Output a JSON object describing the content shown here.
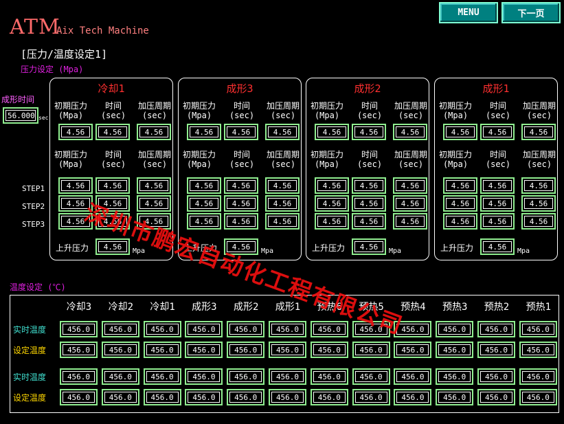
{
  "header": {
    "logo": "ATM",
    "logo_sub": "Aix Tech Machine",
    "menu_label": "MENU",
    "next_label": "下一页",
    "page_title": "[压力/温度设定1]"
  },
  "colors": {
    "accent": "#008080",
    "frame": "#90ee90",
    "title_red": "#ff3030",
    "magenta": "#e020e0",
    "cyan": "#40e0d0",
    "yellow": "#ffd700"
  },
  "pressure": {
    "section_label": "压力设定 (Mpa)",
    "forming_time_label": "成形时间",
    "forming_time_value": "56.000",
    "forming_time_unit": "sec",
    "step_labels": [
      "STEP1",
      "STEP2",
      "STEP3"
    ],
    "rise_label": "上升压力",
    "rise_unit": "Mpa",
    "headers": [
      {
        "name": "初期压力",
        "unit": "(Mpa)"
      },
      {
        "name": "时间",
        "unit": "(sec)"
      },
      {
        "name": "加压周期",
        "unit": "(sec)"
      }
    ],
    "panels": [
      {
        "title": "冷却1",
        "init": [
          "4.56",
          "4.56",
          "4.56"
        ],
        "steps": [
          [
            "4.56",
            "4.56",
            "4.56"
          ],
          [
            "4.56",
            "4.56",
            "4.56"
          ],
          [
            "4.56",
            "4.56",
            "4.56"
          ]
        ],
        "rise": "4.56"
      },
      {
        "title": "成形3",
        "init": [
          "4.56",
          "4.56",
          "4.56"
        ],
        "steps": [
          [
            "4.56",
            "4.56",
            "4.56"
          ],
          [
            "4.56",
            "4.56",
            "4.56"
          ],
          [
            "4.56",
            "4.56",
            "4.56"
          ]
        ],
        "rise": "4.56"
      },
      {
        "title": "成形2",
        "init": [
          "4.56",
          "4.56",
          "4.56"
        ],
        "steps": [
          [
            "4.56",
            "4.56",
            "4.56"
          ],
          [
            "4.56",
            "4.56",
            "4.56"
          ],
          [
            "4.56",
            "4.56",
            "4.56"
          ]
        ],
        "rise": "4.56"
      },
      {
        "title": "成形1",
        "init": [
          "4.56",
          "4.56",
          "4.56"
        ],
        "steps": [
          [
            "4.56",
            "4.56",
            "4.56"
          ],
          [
            "4.56",
            "4.56",
            "4.56"
          ],
          [
            "4.56",
            "4.56",
            "4.56"
          ]
        ],
        "rise": "4.56"
      }
    ]
  },
  "temperature": {
    "section_label": "温度设定 (℃)",
    "columns": [
      "冷却3",
      "冷却2",
      "冷却1",
      "成形3",
      "成形2",
      "成形1",
      "预热6",
      "预热5",
      "预热4",
      "预热3",
      "预热2",
      "预热1"
    ],
    "rows": [
      {
        "label": "实时温度",
        "values": [
          "456.0",
          "456.0",
          "456.0",
          "456.0",
          "456.0",
          "456.0",
          "456.0",
          "456.0",
          "456.0",
          "456.0",
          "456.0",
          "456.0"
        ]
      },
      {
        "label": "设定温度",
        "values": [
          "456.0",
          "456.0",
          "456.0",
          "456.0",
          "456.0",
          "456.0",
          "456.0",
          "456.0",
          "456.0",
          "456.0",
          "456.0",
          "456.0"
        ]
      },
      {
        "label": "实时温度",
        "values": [
          "456.0",
          "456.0",
          "456.0",
          "456.0",
          "456.0",
          "456.0",
          "456.0",
          "456.0",
          "456.0",
          "456.0",
          "456.0",
          "456.0"
        ]
      },
      {
        "label": "设定温度",
        "values": [
          "456.0",
          "456.0",
          "456.0",
          "456.0",
          "456.0",
          "456.0",
          "456.0",
          "456.0",
          "456.0",
          "456.0",
          "456.0",
          "456.0"
        ]
      }
    ]
  },
  "watermark": "深圳市鹏宏自动化工程有限公司"
}
